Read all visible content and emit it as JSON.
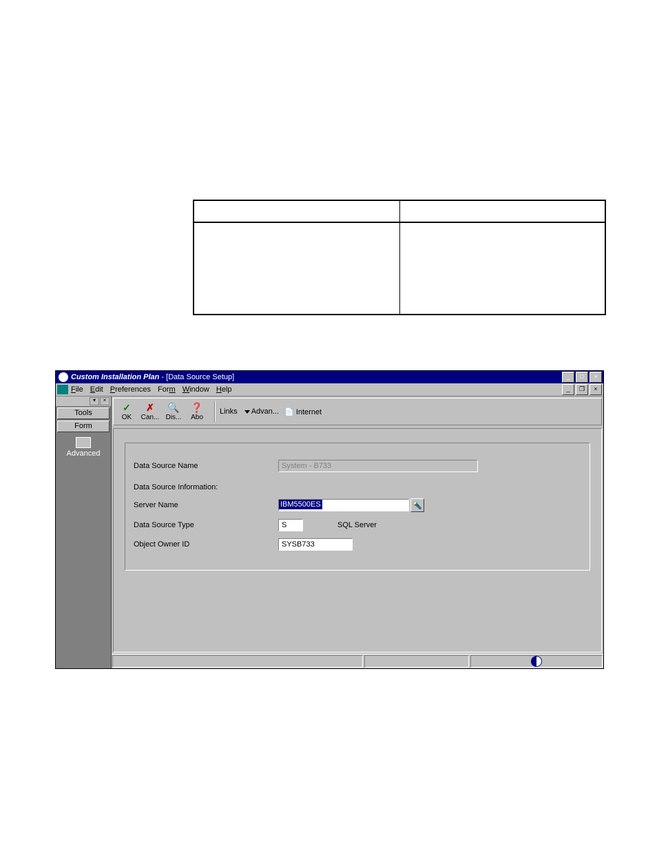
{
  "window": {
    "title_italic": "Custom Installation Plan",
    "title_rest": " - [Data Source Setup]"
  },
  "menu": {
    "items": [
      "File",
      "Edit",
      "Preferences",
      "Form",
      "Window",
      "Help"
    ]
  },
  "sidebar": {
    "btn1": "Tools",
    "btn2": "Form",
    "item1": "Advanced"
  },
  "toolbar": {
    "ok": "OK",
    "can": "Can...",
    "dis": "Dis...",
    "abo": "Abo",
    "links": "Links",
    "advan": "Advan...",
    "internet": "Internet"
  },
  "form": {
    "ds_name_label": "Data Source Name",
    "ds_name_value": "System - B733",
    "section": "Data Source Information:",
    "server_label": "Server Name",
    "server_value": "IBM5500ES",
    "type_label": "Data Source Type",
    "type_value": "S",
    "type_desc": "SQL Server",
    "owner_label": "Object Owner ID",
    "owner_value": "SYSB733"
  }
}
